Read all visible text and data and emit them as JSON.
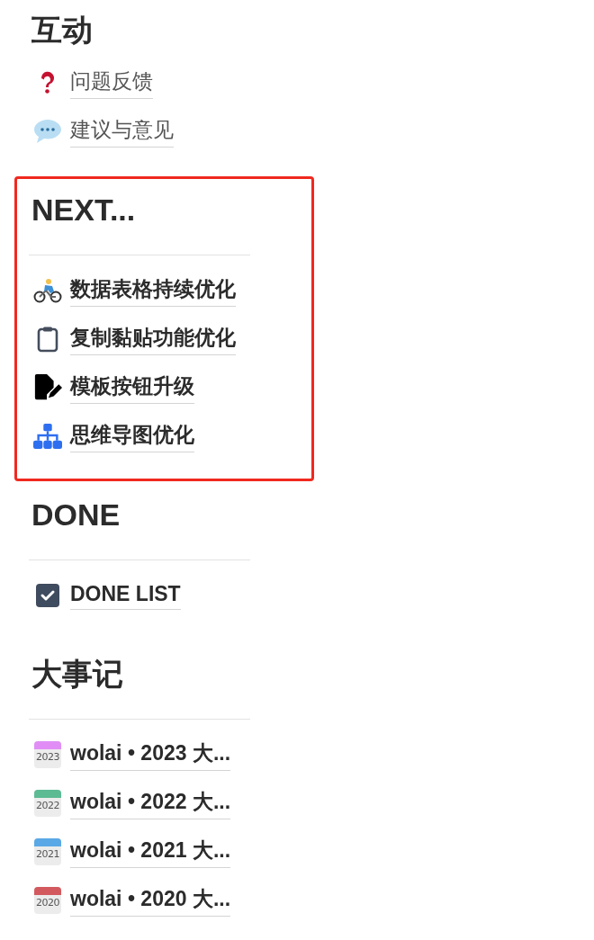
{
  "sections": [
    {
      "title": "互动",
      "divider": false,
      "highlighted": false,
      "items": [
        {
          "label": "问题反馈"
        },
        {
          "label": "建议与意见"
        }
      ]
    },
    {
      "title": "NEXT...",
      "divider": true,
      "highlighted": true,
      "items": [
        {
          "label": "数据表格持续优化"
        },
        {
          "label": "复制黏贴功能优化"
        },
        {
          "label": "模板按钮升级"
        },
        {
          "label": "思维导图优化"
        }
      ]
    },
    {
      "title": "DONE",
      "divider": true,
      "highlighted": false,
      "items": [
        {
          "label": "DONE LIST"
        }
      ]
    },
    {
      "title": "大事记",
      "divider": true,
      "highlighted": false,
      "items": [
        {
          "icon_text": "2023",
          "color": "#e08ef5",
          "label": "wolai • 2023 大..."
        },
        {
          "icon_text": "2022",
          "color": "#5cbb93",
          "label": "wolai • 2022 大..."
        },
        {
          "icon_text": "2021",
          "color": "#5aa8e6",
          "label": "wolai • 2021 大..."
        },
        {
          "icon_text": "2020",
          "color": "#d25a5e",
          "label": "wolai • 2020 大..."
        }
      ]
    }
  ]
}
